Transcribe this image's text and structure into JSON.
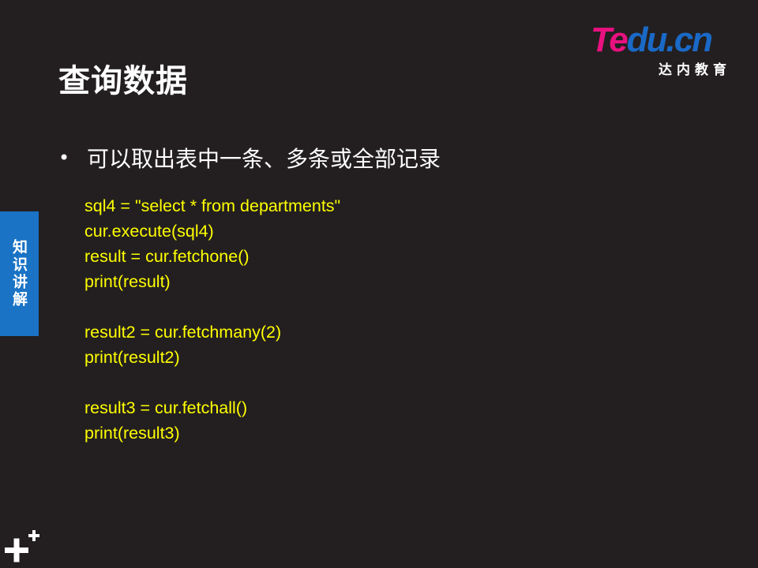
{
  "slide": {
    "title": "查询数据",
    "logo": {
      "word_a": "Te",
      "word_b": "du.cn",
      "subtitle": "达内教育"
    },
    "side_tab": {
      "label": "知识讲解"
    },
    "bullet": {
      "text": "可以取出表中一条、多条或全部记录"
    },
    "code_lines": [
      "sql4 = \"select * from departments\"",
      "cur.execute(sql4)",
      "result = cur.fetchone()",
      "print(result)",
      "",
      "result2 = cur.fetchmany(2)",
      "print(result2)",
      "",
      "result3 = cur.fetchall()",
      "print(result3)"
    ],
    "colors": {
      "background": "#231f20",
      "code": "#ffff00",
      "brand_pink": "#e8117f",
      "brand_blue": "#1a69c7",
      "side_tab": "#1a73c5"
    },
    "icons": {
      "corner": "plus-plus-icon"
    }
  }
}
